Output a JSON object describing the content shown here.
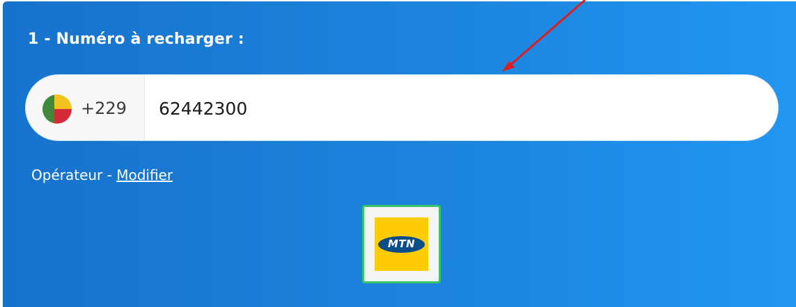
{
  "section": {
    "title": "1 - Numéro à recharger :"
  },
  "phone": {
    "country_flag": "benin-flag-icon",
    "dial_code": "+229",
    "number_value": "62442300"
  },
  "operator": {
    "label": "Opérateur - ",
    "modify_link": "Modifier",
    "selected": {
      "logo_text": "MTN",
      "brand_color": "#ffcb05",
      "selected_border_color": "#37c463"
    }
  },
  "colors": {
    "panel_gradient_start": "#1772cc",
    "panel_gradient_end": "#2196f1",
    "annotation_arrow": "#e01c1c"
  }
}
